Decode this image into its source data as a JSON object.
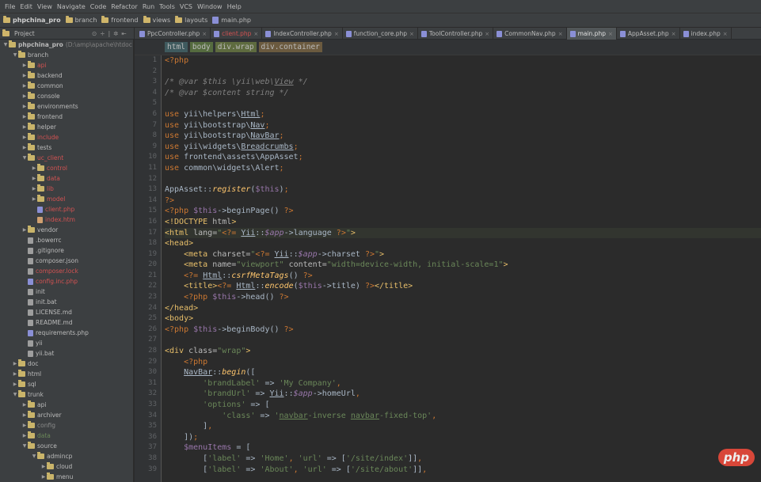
{
  "menu": [
    "File",
    "Edit",
    "View",
    "Navigate",
    "Code",
    "Refactor",
    "Run",
    "Tools",
    "VCS",
    "Window",
    "Help"
  ],
  "breadcrumb": [
    "phpchina_pro",
    "branch",
    "frontend",
    "views",
    "layouts",
    "main.php"
  ],
  "project_panel": {
    "label": "Project"
  },
  "tabs": [
    {
      "label": "PpcController.php",
      "red": false,
      "active": false
    },
    {
      "label": "client.php",
      "red": true,
      "active": false
    },
    {
      "label": "IndexController.php",
      "red": false,
      "active": false
    },
    {
      "label": "function_core.php",
      "red": false,
      "active": false
    },
    {
      "label": "ToolController.php",
      "red": false,
      "active": false
    },
    {
      "label": "CommonNav.php",
      "red": false,
      "active": false
    },
    {
      "label": "main.php",
      "red": false,
      "active": true
    },
    {
      "label": "AppAsset.php",
      "red": false,
      "active": false
    },
    {
      "label": "index.php",
      "red": false,
      "active": false
    }
  ],
  "tree": [
    {
      "d": 0,
      "t": "folder",
      "a": "open",
      "label": "phpchina_pro",
      "note": "(D:\\amp\\apache\\htdoc",
      "bold": true
    },
    {
      "d": 1,
      "t": "folder",
      "a": "open",
      "label": "branch"
    },
    {
      "d": 2,
      "t": "folder",
      "a": "closed",
      "label": "api",
      "c": "red"
    },
    {
      "d": 2,
      "t": "folder",
      "a": "closed",
      "label": "backend"
    },
    {
      "d": 2,
      "t": "folder",
      "a": "closed",
      "label": "common"
    },
    {
      "d": 2,
      "t": "folder",
      "a": "closed",
      "label": "console"
    },
    {
      "d": 2,
      "t": "folder",
      "a": "closed",
      "label": "environments"
    },
    {
      "d": 2,
      "t": "folder",
      "a": "closed",
      "label": "frontend"
    },
    {
      "d": 2,
      "t": "folder",
      "a": "closed",
      "label": "helper"
    },
    {
      "d": 2,
      "t": "folder",
      "a": "closed",
      "label": "include",
      "c": "red"
    },
    {
      "d": 2,
      "t": "folder",
      "a": "closed",
      "label": "tests"
    },
    {
      "d": 2,
      "t": "folder",
      "a": "open",
      "label": "uc_client",
      "c": "red"
    },
    {
      "d": 3,
      "t": "folder",
      "a": "closed",
      "label": "control",
      "c": "red"
    },
    {
      "d": 3,
      "t": "folder",
      "a": "closed",
      "label": "data",
      "c": "red"
    },
    {
      "d": 3,
      "t": "folder",
      "a": "closed",
      "label": "lib",
      "c": "red"
    },
    {
      "d": 3,
      "t": "folder",
      "a": "closed",
      "label": "model",
      "c": "red"
    },
    {
      "d": 3,
      "t": "file",
      "f": "php",
      "label": "client.php",
      "c": "red"
    },
    {
      "d": 3,
      "t": "file",
      "f": "red",
      "label": "index.htm",
      "c": "red"
    },
    {
      "d": 2,
      "t": "folder",
      "a": "closed",
      "label": "vendor"
    },
    {
      "d": 2,
      "t": "file",
      "label": ".bowerrc"
    },
    {
      "d": 2,
      "t": "file",
      "label": ".gitignore"
    },
    {
      "d": 2,
      "t": "file",
      "label": "composer.json"
    },
    {
      "d": 2,
      "t": "file",
      "label": "composer.lock",
      "c": "red"
    },
    {
      "d": 2,
      "t": "file",
      "f": "php",
      "label": "config.inc.php",
      "c": "red"
    },
    {
      "d": 2,
      "t": "file",
      "label": "init"
    },
    {
      "d": 2,
      "t": "file",
      "label": "init.bat"
    },
    {
      "d": 2,
      "t": "file",
      "label": "LICENSE.md"
    },
    {
      "d": 2,
      "t": "file",
      "label": "README.md"
    },
    {
      "d": 2,
      "t": "file",
      "f": "php",
      "label": "requirements.php"
    },
    {
      "d": 2,
      "t": "file",
      "label": "yii"
    },
    {
      "d": 2,
      "t": "file",
      "label": "yii.bat"
    },
    {
      "d": 1,
      "t": "folder",
      "a": "closed",
      "label": "doc"
    },
    {
      "d": 1,
      "t": "folder",
      "a": "closed",
      "label": "html"
    },
    {
      "d": 1,
      "t": "folder",
      "a": "closed",
      "label": "sql"
    },
    {
      "d": 1,
      "t": "folder",
      "a": "open",
      "label": "trunk"
    },
    {
      "d": 2,
      "t": "folder",
      "a": "closed",
      "label": "api"
    },
    {
      "d": 2,
      "t": "folder",
      "a": "closed",
      "label": "archiver"
    },
    {
      "d": 2,
      "t": "folder",
      "a": "closed",
      "label": "config",
      "c": "grey"
    },
    {
      "d": 2,
      "t": "folder",
      "a": "closed",
      "label": "data",
      "c": "green"
    },
    {
      "d": 2,
      "t": "folder",
      "a": "open",
      "label": "source"
    },
    {
      "d": 3,
      "t": "folder",
      "a": "open",
      "label": "admincp"
    },
    {
      "d": 4,
      "t": "folder",
      "a": "closed",
      "label": "cloud"
    },
    {
      "d": 4,
      "t": "folder",
      "a": "closed",
      "label": "menu"
    }
  ],
  "tag_crumbs": [
    "html",
    "body",
    "div.wrap",
    "div.container"
  ],
  "code_lines": [
    [
      [
        "kw",
        "<?php"
      ]
    ],
    [],
    [
      [
        "cm",
        "/* "
      ],
      [
        "cmdoc",
        "@var"
      ],
      [
        "cm",
        " $this \\yii\\web\\"
      ],
      [
        "cmu",
        "View"
      ],
      [
        "cm",
        " */"
      ]
    ],
    [
      [
        "cm",
        "/* "
      ],
      [
        "cmdoc",
        "@var"
      ],
      [
        "cm",
        " $content string */"
      ]
    ],
    [],
    [
      [
        "kw",
        "use"
      ],
      [
        "tx",
        " yii\\helpers\\"
      ],
      [
        "txu",
        "Html"
      ],
      [
        "kw",
        ";"
      ]
    ],
    [
      [
        "kw",
        "use"
      ],
      [
        "tx",
        " yii\\bootstrap\\"
      ],
      [
        "txu",
        "Nav"
      ],
      [
        "kw",
        ";"
      ]
    ],
    [
      [
        "kw",
        "use"
      ],
      [
        "tx",
        " yii\\bootstrap\\"
      ],
      [
        "txu",
        "NavBar"
      ],
      [
        "kw",
        ";"
      ]
    ],
    [
      [
        "kw",
        "use"
      ],
      [
        "tx",
        " yii\\widgets\\"
      ],
      [
        "txu",
        "Breadcrumbs"
      ],
      [
        "kw",
        ";"
      ]
    ],
    [
      [
        "kw",
        "use"
      ],
      [
        "tx",
        " frontend\\assets\\AppAsset"
      ],
      [
        "kw",
        ";"
      ]
    ],
    [
      [
        "kw",
        "use"
      ],
      [
        "tx",
        " common\\widgets\\Alert"
      ],
      [
        "kw",
        ";"
      ]
    ],
    [],
    [
      [
        "tx",
        "AppAsset::"
      ],
      [
        "fn",
        "register"
      ],
      [
        "tx",
        "("
      ],
      [
        "vr",
        "$this"
      ],
      [
        "tx",
        ")"
      ],
      [
        "kw",
        ";"
      ]
    ],
    [
      [
        "kw",
        "?>"
      ]
    ],
    [
      [
        "kw",
        "<?php "
      ],
      [
        "vr",
        "$this"
      ],
      [
        "tx",
        "->beginPage() "
      ],
      [
        "kw",
        "?>"
      ]
    ],
    [
      [
        "tg",
        "<!DOCTYPE "
      ],
      [
        "attr",
        "html"
      ],
      [
        "tg",
        ">"
      ]
    ],
    [
      [
        "tg",
        "<html "
      ],
      [
        "attr",
        "lang="
      ],
      [
        "st",
        "\""
      ],
      [
        "kw",
        "<?= "
      ],
      [
        "txu",
        "Yii"
      ],
      [
        "tx",
        "::"
      ],
      [
        "vri",
        "$app"
      ],
      [
        "tx",
        "->language "
      ],
      [
        "kw",
        "?>"
      ],
      [
        "st",
        "\""
      ],
      [
        "tg",
        ">"
      ]
    ],
    [
      [
        "tg",
        "<head>"
      ]
    ],
    [
      [
        "tx",
        "    "
      ],
      [
        "tg",
        "<meta "
      ],
      [
        "attr",
        "charset="
      ],
      [
        "st",
        "\""
      ],
      [
        "kw",
        "<?= "
      ],
      [
        "txu",
        "Yii"
      ],
      [
        "tx",
        "::"
      ],
      [
        "vri",
        "$app"
      ],
      [
        "tx",
        "->charset "
      ],
      [
        "kw",
        "?>"
      ],
      [
        "st",
        "\""
      ],
      [
        "tg",
        ">"
      ]
    ],
    [
      [
        "tx",
        "    "
      ],
      [
        "tg",
        "<meta "
      ],
      [
        "attr",
        "name="
      ],
      [
        "st",
        "\"viewport\""
      ],
      [
        "attr",
        " content="
      ],
      [
        "st",
        "\"width=device-width, initial-scale=1\""
      ],
      [
        "tg",
        ">"
      ]
    ],
    [
      [
        "tx",
        "    "
      ],
      [
        "kw",
        "<?= "
      ],
      [
        "txu",
        "Html"
      ],
      [
        "tx",
        "::"
      ],
      [
        "fn",
        "csrfMetaTags"
      ],
      [
        "tx",
        "() "
      ],
      [
        "kw",
        "?>"
      ]
    ],
    [
      [
        "tx",
        "    "
      ],
      [
        "tg",
        "<title>"
      ],
      [
        "kw",
        "<?= "
      ],
      [
        "txu",
        "Html"
      ],
      [
        "tx",
        "::"
      ],
      [
        "fn",
        "encode"
      ],
      [
        "tx",
        "("
      ],
      [
        "vr",
        "$this"
      ],
      [
        "tx",
        "->title) "
      ],
      [
        "kw",
        "?>"
      ],
      [
        "tg",
        "</title>"
      ]
    ],
    [
      [
        "tx",
        "    "
      ],
      [
        "kw",
        "<?php "
      ],
      [
        "vr",
        "$this"
      ],
      [
        "tx",
        "->head() "
      ],
      [
        "kw",
        "?>"
      ]
    ],
    [
      [
        "tg",
        "</head>"
      ]
    ],
    [
      [
        "tg",
        "<body>"
      ]
    ],
    [
      [
        "kw",
        "<?php "
      ],
      [
        "vr",
        "$this"
      ],
      [
        "tx",
        "->beginBody() "
      ],
      [
        "kw",
        "?>"
      ]
    ],
    [],
    [
      [
        "tg",
        "<div "
      ],
      [
        "attr",
        "class="
      ],
      [
        "st",
        "\"wrap\""
      ],
      [
        "tg",
        ">"
      ]
    ],
    [
      [
        "tx",
        "    "
      ],
      [
        "kw",
        "<?php"
      ]
    ],
    [
      [
        "tx",
        "    "
      ],
      [
        "txu",
        "NavBar"
      ],
      [
        "tx",
        "::"
      ],
      [
        "fn",
        "begin"
      ],
      [
        "tx",
        "(["
      ]
    ],
    [
      [
        "tx",
        "        "
      ],
      [
        "st",
        "'brandLabel'"
      ],
      [
        "tx",
        " => "
      ],
      [
        "st",
        "'My Company'"
      ],
      [
        "kw",
        ","
      ]
    ],
    [
      [
        "tx",
        "        "
      ],
      [
        "st",
        "'brandUrl'"
      ],
      [
        "tx",
        " => "
      ],
      [
        "txu",
        "Yii"
      ],
      [
        "tx",
        "::"
      ],
      [
        "vri",
        "$app"
      ],
      [
        "tx",
        "->homeUrl"
      ],
      [
        "kw",
        ","
      ]
    ],
    [
      [
        "tx",
        "        "
      ],
      [
        "st",
        "'options'"
      ],
      [
        "tx",
        " => ["
      ]
    ],
    [
      [
        "tx",
        "            "
      ],
      [
        "st",
        "'class'"
      ],
      [
        "tx",
        " => "
      ],
      [
        "st",
        "'"
      ],
      [
        "stu",
        "navbar"
      ],
      [
        "st",
        "-inverse "
      ],
      [
        "stu",
        "navbar"
      ],
      [
        "st",
        "-fixed-top'"
      ],
      [
        "kw",
        ","
      ]
    ],
    [
      [
        "tx",
        "        ]"
      ],
      [
        "kw",
        ","
      ]
    ],
    [
      [
        "tx",
        "    ])"
      ],
      [
        "kw",
        ";"
      ]
    ],
    [
      [
        "tx",
        "    "
      ],
      [
        "vr",
        "$menuItems"
      ],
      [
        "tx",
        " = ["
      ]
    ],
    [
      [
        "tx",
        "        ["
      ],
      [
        "st",
        "'label'"
      ],
      [
        "tx",
        " => "
      ],
      [
        "st",
        "'Home'"
      ],
      [
        "kw",
        ", "
      ],
      [
        "st",
        "'url'"
      ],
      [
        "tx",
        " => ["
      ],
      [
        "st",
        "'/site/index'"
      ],
      [
        "tx",
        "]]"
      ],
      [
        "kw",
        ","
      ]
    ],
    [
      [
        "tx",
        "        ["
      ],
      [
        "st",
        "'label'"
      ],
      [
        "tx",
        " => "
      ],
      [
        "st",
        "'About'"
      ],
      [
        "kw",
        ", "
      ],
      [
        "st",
        "'url'"
      ],
      [
        "tx",
        " => ["
      ],
      [
        "st",
        "'/site/about'"
      ],
      [
        "tx",
        "]]"
      ],
      [
        "kw",
        ","
      ]
    ]
  ],
  "watermark": "php"
}
